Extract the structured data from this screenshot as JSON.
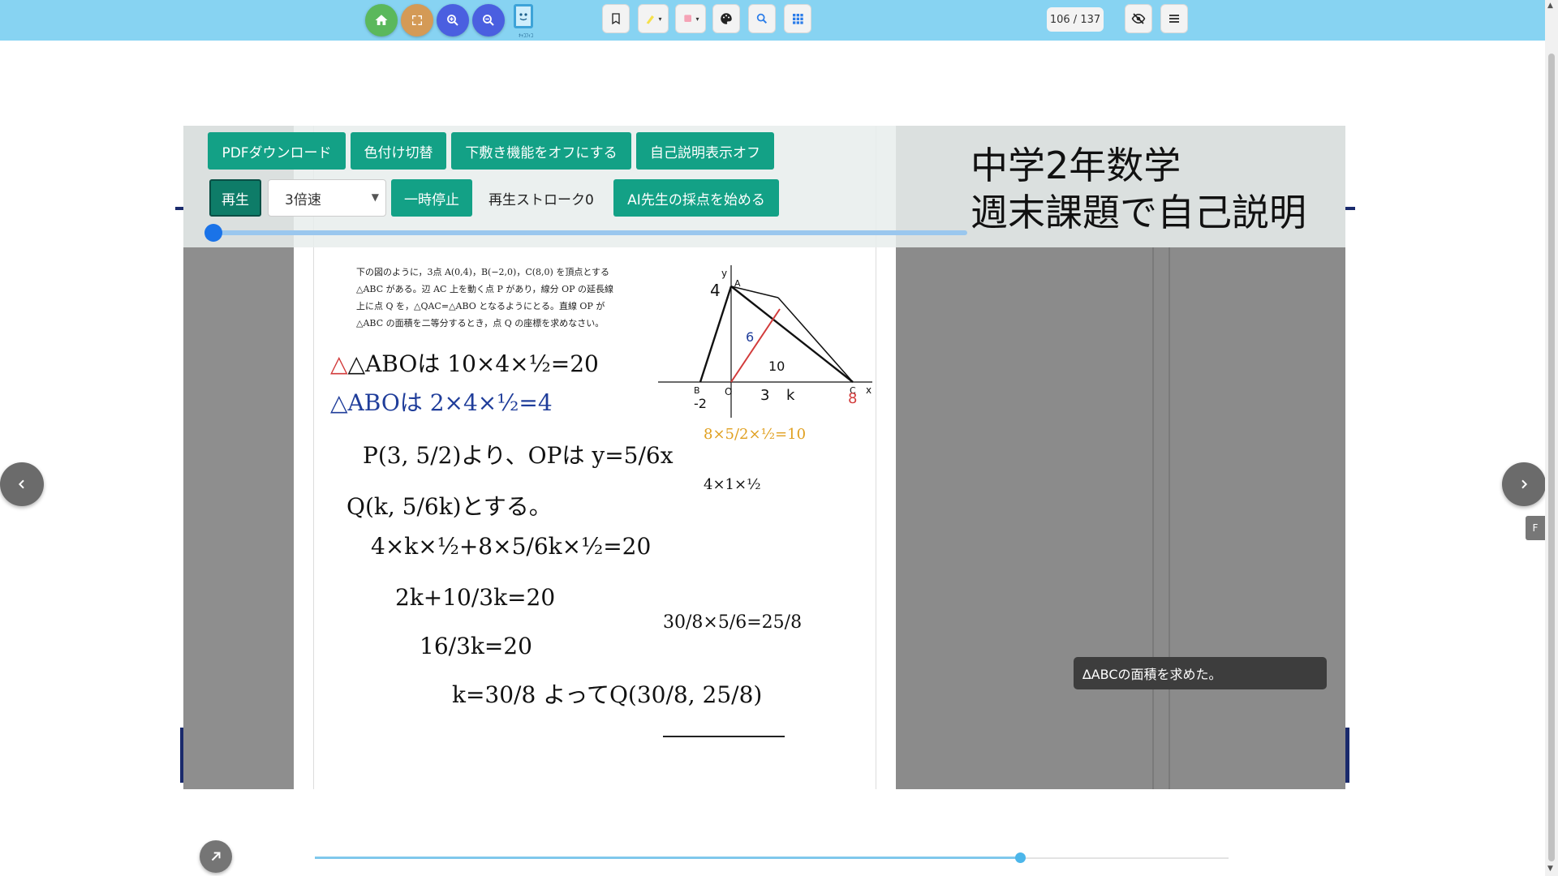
{
  "toolbar": {
    "page_indicator": "106 / 137",
    "logo_caption": "ｷｬｺﾌｨｺ"
  },
  "controls": {
    "pdf_download": "PDFダウンロード",
    "color_toggle": "色付け切替",
    "underlay_off": "下敷き機能をオフにする",
    "explanation_off": "自己説明表示オフ",
    "play": "再生",
    "speed_selected": "3倍速",
    "pause": "一時停止",
    "stroke_count": "再生ストローク0",
    "ai_grading": "AI先生の採点を始める"
  },
  "title": {
    "line1": "中学2年数学",
    "line2": "週末課題で自己説明"
  },
  "caption": "∆ABCの面積を求めた。",
  "problem_text": "下の図のように，3点 A(0,4)，B(−2,0)，C(8,0) を頂点とする △ABC がある。辺 AC 上を動く点 P があり，線分 OP の延長線上に点 Q を，△QAC=△ABO となるようにとる。直線 OP が △ABC の面積を二等分するとき，点 Q の座標を求めなさい。",
  "handwriting": {
    "l1": "△ABOは 10×4×½=20",
    "l2": "△ABOは 2×4×½=4",
    "l3": "P(3, 5/2)より、OPは y=5/6x",
    "l4": "Q(k, 5/6k)とする。",
    "l5": "4×k×½+8×5/6k×½=20",
    "l6": "2k+10/3k=20",
    "l7": "16/3k=20",
    "l8": "k=30/8  よってQ(30/8, 25/8)",
    "side1": "8×5/2×½=10",
    "side2": "4×1×½",
    "side3": "30/8×5/6=25/8"
  },
  "diagram_labels": {
    "y": "y",
    "x": "x",
    "o": "O",
    "b": "B",
    "c": "C",
    "a": "A",
    "four": "4",
    "neg2": "-2",
    "three": "3",
    "k": "k",
    "eight": "8",
    "ten": "10",
    "six": "6"
  },
  "side_tab": "F",
  "colors": {
    "toolbar": "#87d3f2",
    "accent_green": "#13a186",
    "home": "#5bb85c",
    "fullscreen": "#d49a56",
    "zoom": "#4a5fe0"
  }
}
